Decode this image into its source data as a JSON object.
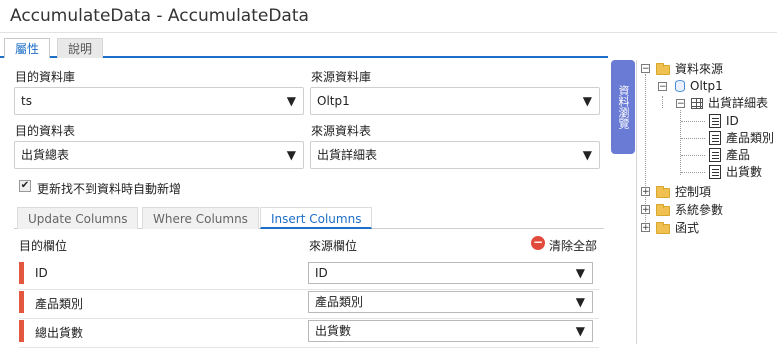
{
  "window": {
    "title": "AccumulateData - AccumulateData"
  },
  "tabs": {
    "properties": "屬性",
    "description": "說明"
  },
  "form": {
    "target_db_label": "目的資料庫",
    "target_db_value": "ts",
    "source_db_label": "來源資料庫",
    "source_db_value": "Oltp1",
    "target_table_label": "目的資料表",
    "target_table_value": "出貨總表",
    "source_table_label": "來源資料表",
    "source_table_value": "出貨詳細表",
    "auto_add_label": "更新找不到資料時自動新增",
    "auto_add_checked": true
  },
  "subtabs": {
    "update": "Update Columns",
    "where": "Where Columns",
    "insert": "Insert Columns",
    "active": "insert"
  },
  "grid": {
    "header_target": "目的欄位",
    "header_source": "來源欄位",
    "clear_all": "清除全部",
    "rows": [
      {
        "target": "ID",
        "source": "ID"
      },
      {
        "target": "產品類別",
        "source": "產品類別"
      },
      {
        "target": "總出貨數",
        "source": "出貨數"
      }
    ]
  },
  "side_panel": {
    "tab_label": "資料瀏覽"
  },
  "tree": {
    "data_source": "資料來源",
    "db": "Oltp1",
    "table": "出貨詳細表",
    "fields": [
      "ID",
      "產品類別",
      "產品",
      "出貨數"
    ],
    "control_items": "控制項",
    "system_params": "系統參數",
    "functions": "函式"
  },
  "colors": {
    "accent": "#1e6fc8",
    "row_marker": "#e4573f",
    "side_tab": "#6a7bd6",
    "clear_icon": "#e24b3b"
  }
}
